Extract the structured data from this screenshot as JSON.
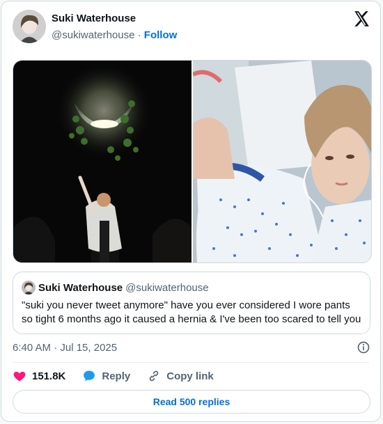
{
  "author": {
    "name": "Suki Waterhouse",
    "handle": "@sukiwaterhouse",
    "separator": "·",
    "follow_label": "Follow"
  },
  "quote": {
    "name": "Suki Waterhouse",
    "handle": "@sukiwaterhouse",
    "text": "\"suki you never tweet anymore\" have you ever considered I wore pants so tight 6 months ago it caused a hernia & I've been too scared to tell you"
  },
  "timestamp": "6:40 AM · Jul 15, 2025",
  "actions": {
    "likes": "151.8K",
    "reply_label": "Reply",
    "copy_label": "Copy link"
  },
  "read_replies_label": "Read 500 replies",
  "colors": {
    "link": "#006fd6",
    "like": "#f91880",
    "reply": "#1d9bf0",
    "muted": "#536471"
  },
  "icons": [
    "x-logo-icon",
    "heart-icon",
    "reply-icon",
    "link-icon",
    "info-icon"
  ]
}
